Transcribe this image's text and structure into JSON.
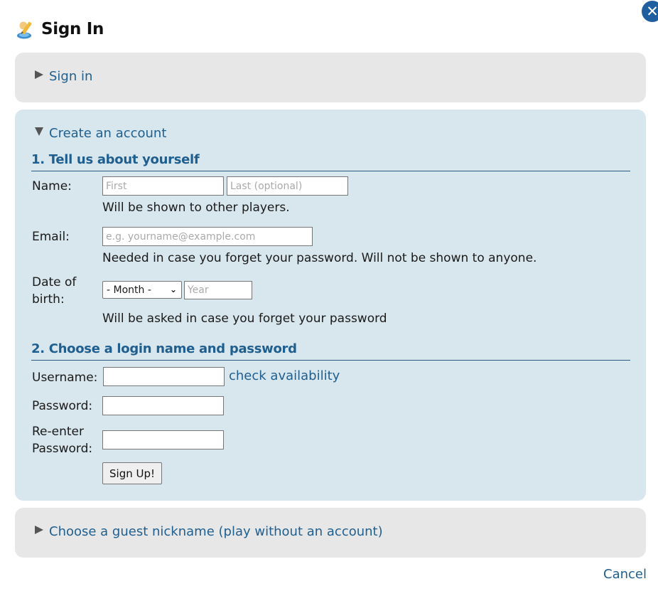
{
  "dialog": {
    "title": "Sign In",
    "close_glyph": "✕"
  },
  "sections": {
    "signin": {
      "label": "Sign in"
    },
    "create": {
      "label": "Create an account"
    },
    "guest": {
      "label": "Choose a guest nickname (play without an account)"
    }
  },
  "about": {
    "heading": "1. Tell us about yourself",
    "name_label": "Name:",
    "first_placeholder": "First",
    "last_placeholder": "Last (optional)",
    "name_hint": "Will be shown to other players.",
    "email_label": "Email:",
    "email_placeholder": "e.g. yourname@example.com",
    "email_hint": "Needed in case you forget your password. Will not be shown to anyone.",
    "dob_label_1": "Date of",
    "dob_label_2": "birth:",
    "month_selected": "- Month -",
    "year_placeholder": "Year",
    "dob_hint": "Will be asked in case you forget your password"
  },
  "login": {
    "heading": "2. Choose a login name and password",
    "username_label": "Username:",
    "check_availability": "check availability",
    "password_label": "Password:",
    "reenter_label_1": "Re-enter",
    "reenter_label_2": "Password:",
    "signup_button": "Sign Up!"
  },
  "footer": {
    "cancel": "Cancel"
  },
  "icons": {
    "title": "user-pencil-icon",
    "close": "close-icon",
    "expand": "triangle-right-icon",
    "collapse": "triangle-down-icon",
    "select": "chevron-down-icon"
  },
  "colors": {
    "link": "#1f5f8f",
    "close_button": "#1f5fa0",
    "panel_gray": "#e7e7e7",
    "panel_blue": "#d8e6ed"
  }
}
